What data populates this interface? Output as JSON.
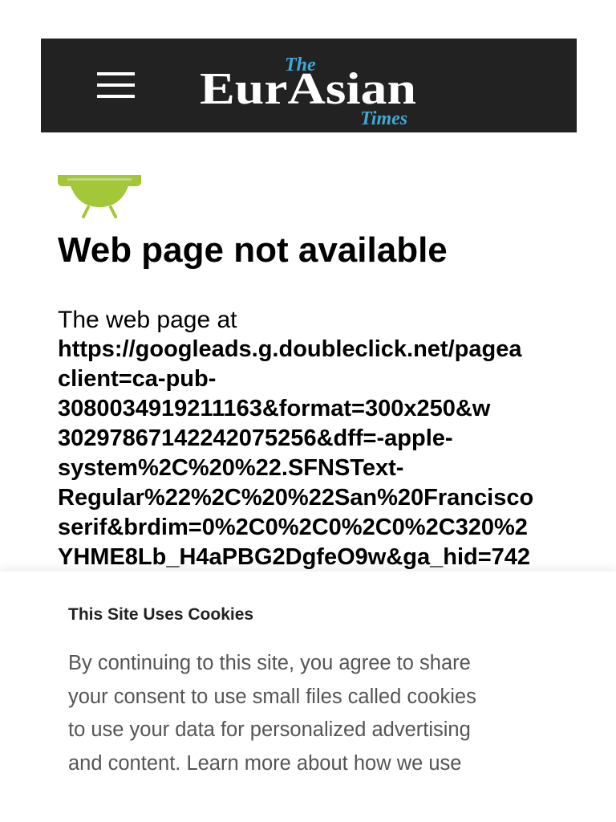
{
  "header": {
    "menu_icon": "hamburger-menu-icon",
    "logo": {
      "the": "The",
      "main": "EurAsian",
      "times": "Times"
    }
  },
  "ad_frame": {
    "icon": "android-robot-icon",
    "error_title": "Web page not available",
    "intro": "The web page at",
    "url_lines": [
      "https://googleads.g.doubleclick.net/pagea",
      "client=ca-pub-",
      "3080034919211163&format=300x250&w",
      "3029786714224207525​6&dff=-apple-",
      "system%2C%20%22.SFNSText-",
      "Regular%22%2C%20%22San%20Francisco",
      "serif&brdim=0%2C0%2C0%2C0%2C320%2",
      "YHME8Lb_H4aPBG2DgfeO9w&ga_hid=742"
    ]
  },
  "cookie_notice": {
    "title": "This Site Uses Cookies",
    "lines": [
      "By continuing to this site, you agree to share",
      "your consent to use small files called cookies",
      "to use your data for personalized advertising",
      "and content. Learn more about how we use"
    ]
  },
  "colors": {
    "header_bg": "#222222",
    "logo_white": "#ffffff",
    "logo_blue": "#3fa9d6",
    "android_green": "#a4c639"
  }
}
